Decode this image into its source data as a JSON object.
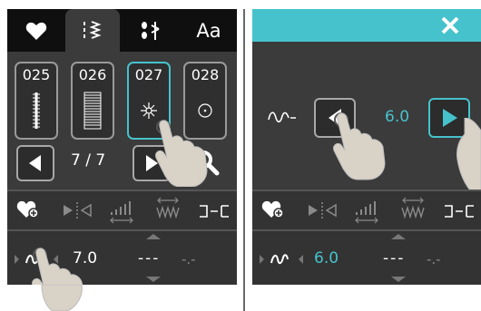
{
  "left": {
    "tabs": [
      {
        "label": "",
        "icon": "heart-icon"
      },
      {
        "label": "",
        "icon": "stitch-list-icon"
      },
      {
        "label": "",
        "icon": "decorative-stitch-icon"
      },
      {
        "label": "Aa",
        "icon": "font-icon"
      }
    ],
    "cards": [
      {
        "number": "025",
        "icon": "buttonhole-stitch-icon"
      },
      {
        "number": "026",
        "icon": "wide-buttonhole-icon"
      },
      {
        "number": "027",
        "icon": "eyelet-star-icon",
        "selected": true
      },
      {
        "number": "028",
        "icon": "eyelet-round-icon"
      }
    ],
    "page": "7 / 7",
    "width_value": "7.0",
    "length_value": "---",
    "tension_value": "-.-"
  },
  "right": {
    "close_icon": "close-icon",
    "width_value": "6.0",
    "bottom_width_value": "6.0",
    "length_value": "---",
    "tension_value": "-.-"
  },
  "colors": {
    "accent": "#46c2cc",
    "panel": "#3b3b3b",
    "tabbar": "#0f0f0f"
  }
}
